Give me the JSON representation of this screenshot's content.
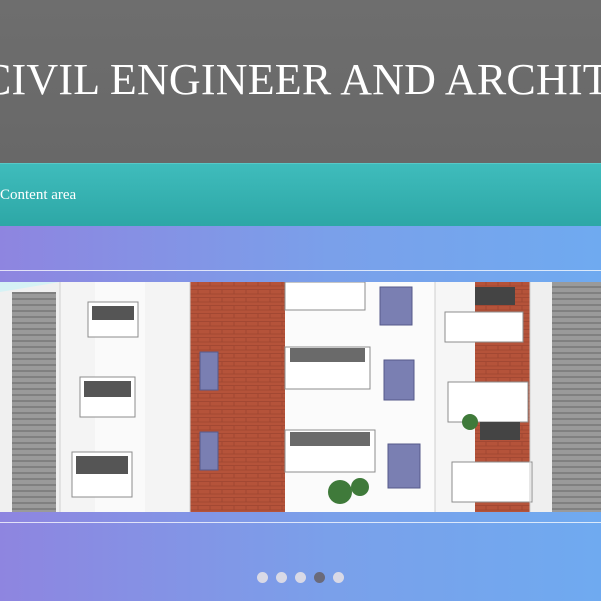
{
  "header": {
    "title": "CIVIL ENGINEER AND ARCHITECT"
  },
  "nav": {
    "items": [
      {
        "label": "Content area"
      }
    ]
  },
  "slider": {
    "image": "apartment-building-photo",
    "slides_count": 5,
    "active_index": 3
  },
  "colors": {
    "header_bg": "#6b6b6b",
    "nav_bg": "#35b2b1",
    "band_start": "#8e85e0",
    "band_end": "#6faaf0",
    "dot": "#d9d9e6",
    "dot_active": "#6a6a7a"
  }
}
